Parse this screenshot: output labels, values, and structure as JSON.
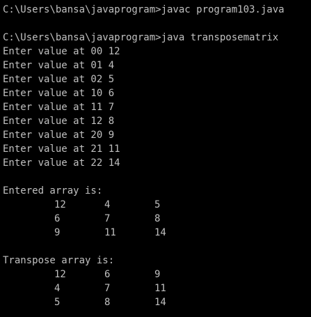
{
  "commands": [
    "C:\\Users\\bansa\\javaprogram>javac program103.java",
    "C:\\Users\\bansa\\javaprogram>java transposematrix"
  ],
  "input_lines": [
    "Enter value at 00 12",
    "Enter value at 01 4",
    "Enter value at 02 5",
    "Enter value at 10 6",
    "Enter value at 11 7",
    "Enter value at 12 8",
    "Enter value at 20 9",
    "Enter value at 21 11",
    "Enter value at 22 14"
  ],
  "entered": {
    "heading": "Entered array is:",
    "rows": [
      [
        "12",
        "4",
        "5"
      ],
      [
        "6",
        "7",
        "8"
      ],
      [
        "9",
        "11",
        "14"
      ]
    ]
  },
  "transpose": {
    "heading": "Transpose array is:",
    "rows": [
      [
        "12",
        "6",
        "9"
      ],
      [
        "4",
        "7",
        "11"
      ],
      [
        "5",
        "8",
        "14"
      ]
    ]
  },
  "colors": {
    "background": "#000000",
    "text": "#c0c0c0"
  }
}
